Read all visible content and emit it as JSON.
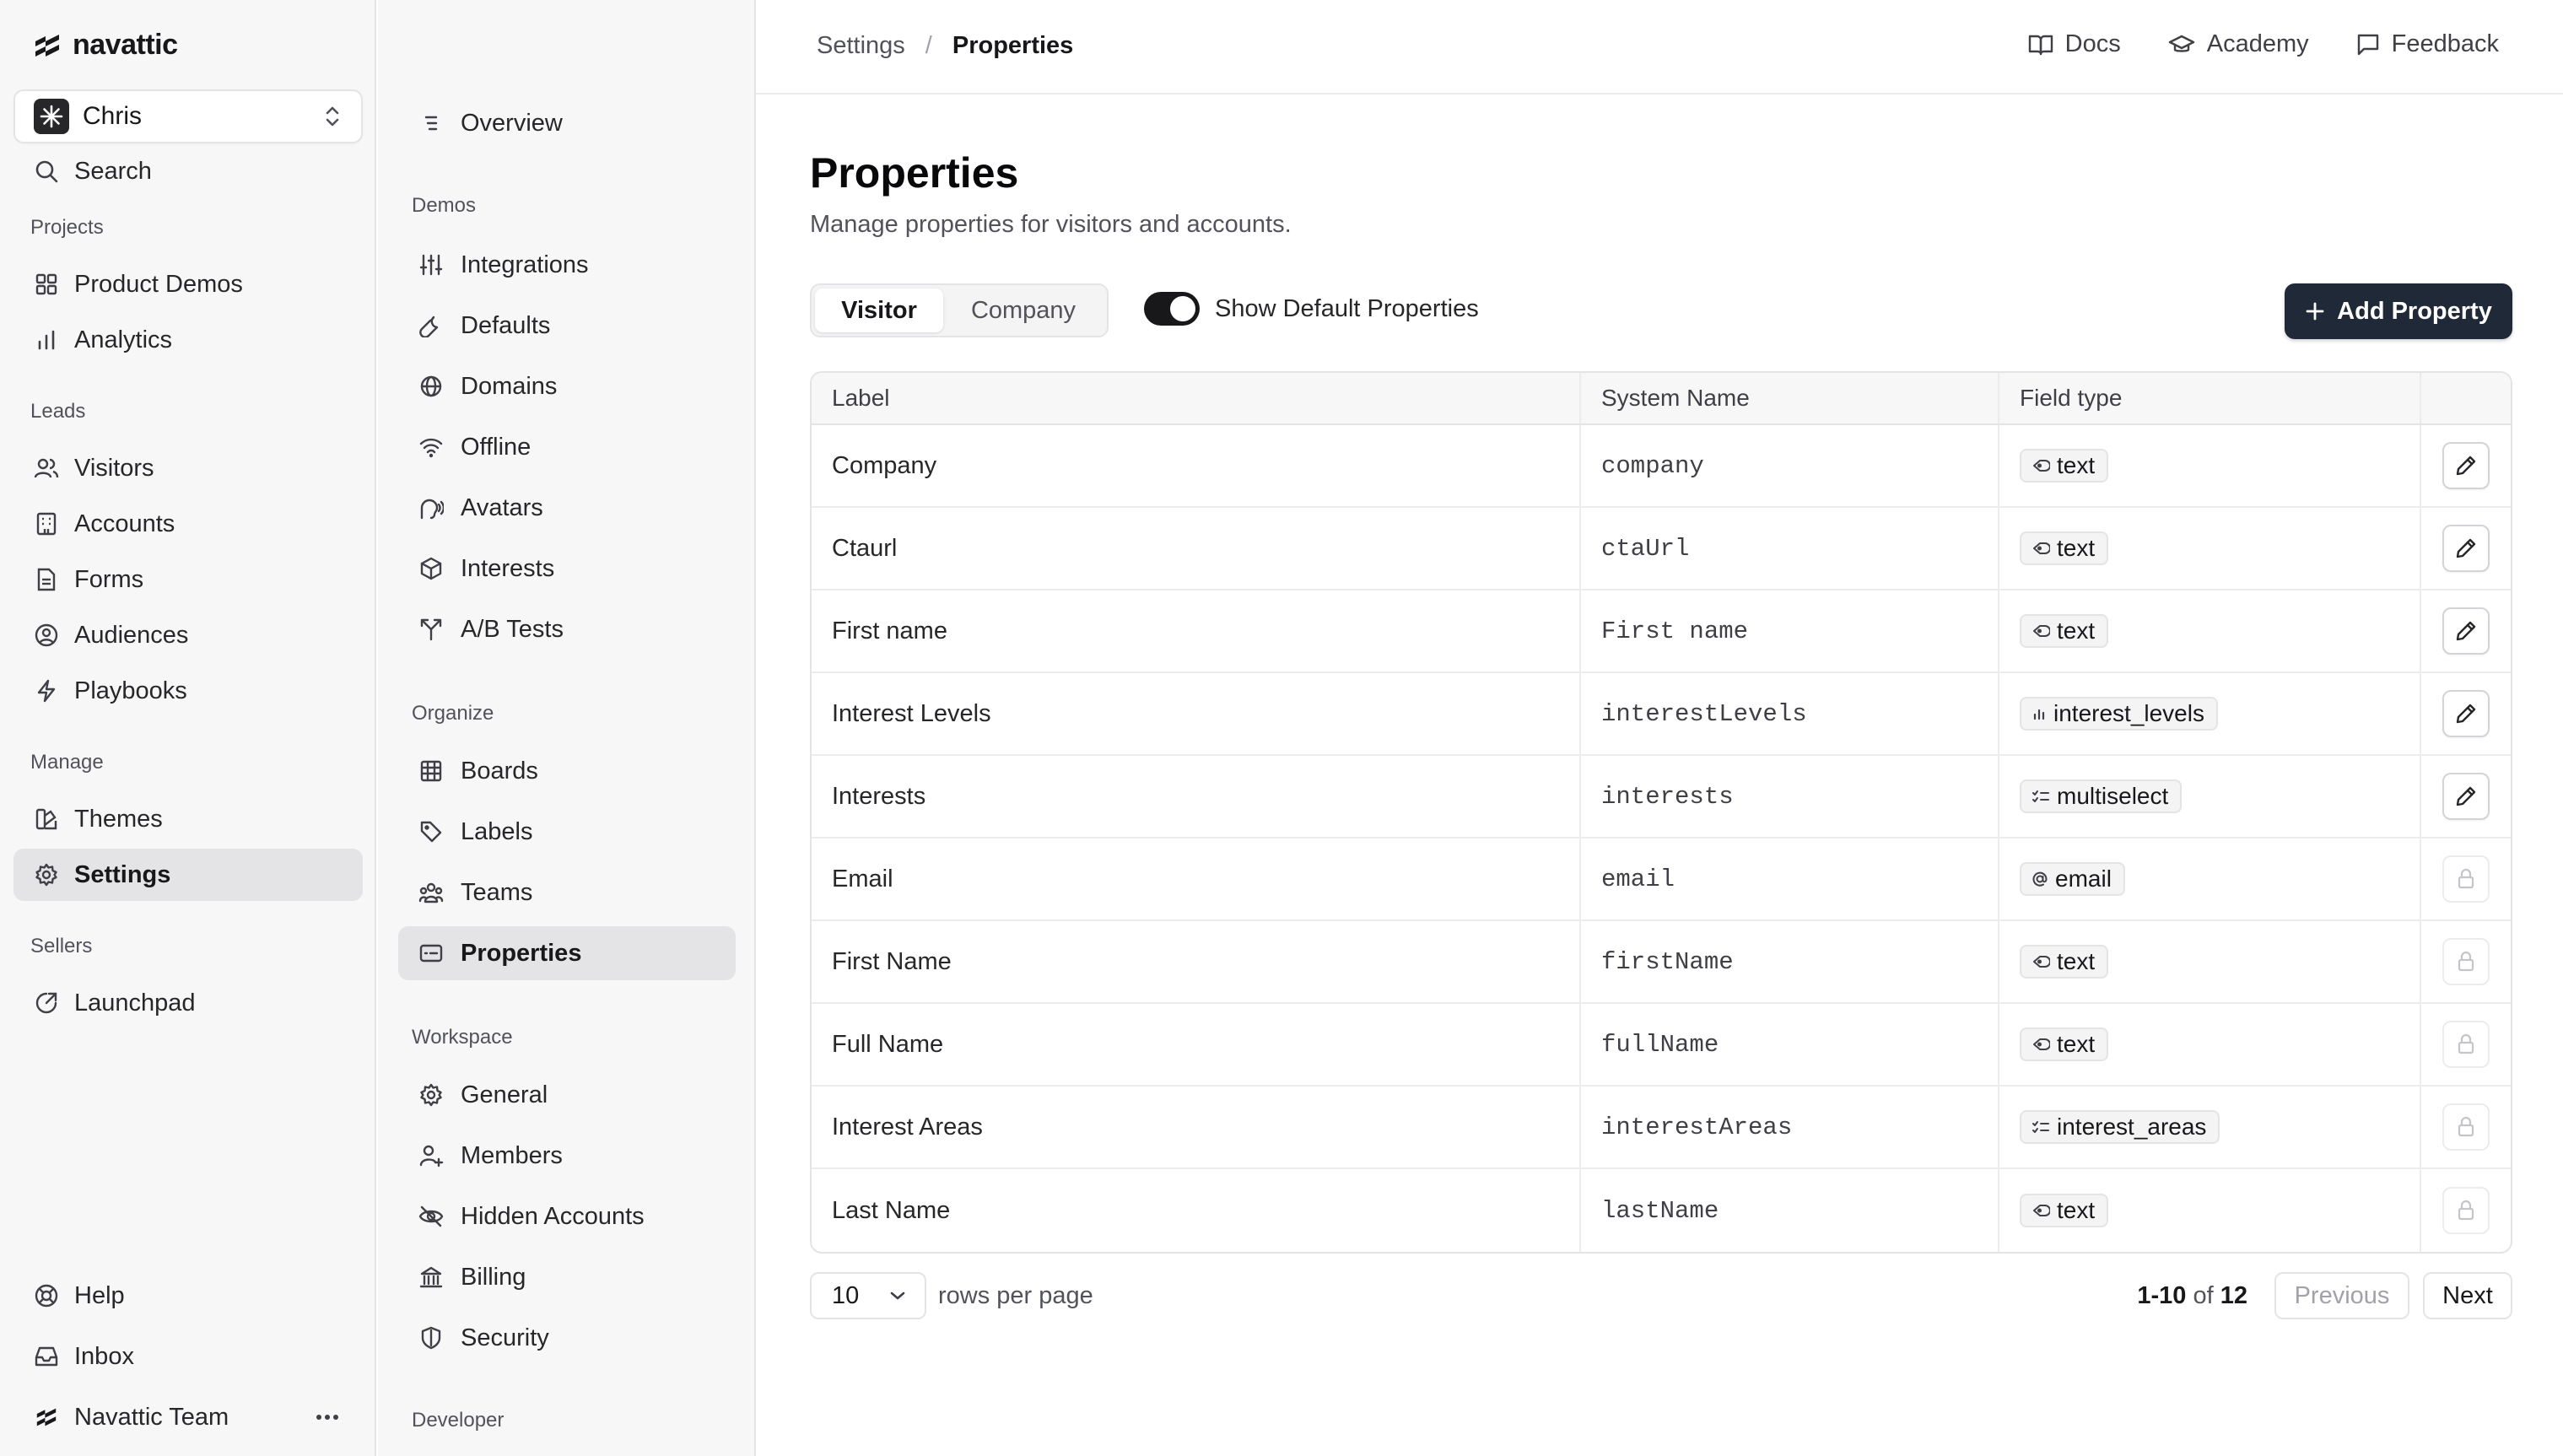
{
  "app": {
    "logo_text": "navattic"
  },
  "user": {
    "name": "Chris"
  },
  "sidebar": {
    "search_label": "Search",
    "sections": {
      "projects": "Projects",
      "leads": "Leads",
      "manage": "Manage",
      "sellers": "Sellers"
    },
    "items": {
      "product_demos": "Product Demos",
      "analytics": "Analytics",
      "visitors": "Visitors",
      "accounts": "Accounts",
      "forms": "Forms",
      "audiences": "Audiences",
      "playbooks": "Playbooks",
      "themes": "Themes",
      "settings": "Settings",
      "launchpad": "Launchpad"
    },
    "footer": {
      "help": "Help",
      "inbox": "Inbox",
      "team": "Navattic Team"
    }
  },
  "settings_nav": {
    "overview": "Overview",
    "sections": {
      "demos": "Demos",
      "organize": "Organize",
      "workspace": "Workspace",
      "developer": "Developer"
    },
    "demos": [
      "Integrations",
      "Defaults",
      "Domains",
      "Offline",
      "Avatars",
      "Interests",
      "A/B Tests"
    ],
    "organize": [
      "Boards",
      "Labels",
      "Teams",
      "Properties"
    ],
    "workspace": [
      "General",
      "Members",
      "Hidden Accounts",
      "Billing",
      "Security"
    ]
  },
  "topbar": {
    "breadcrumb_parent": "Settings",
    "breadcrumb_separator": "/",
    "breadcrumb_current": "Properties",
    "links": {
      "docs": "Docs",
      "academy": "Academy",
      "feedback": "Feedback"
    }
  },
  "page": {
    "title": "Properties",
    "subtitle": "Manage properties for visitors and accounts.",
    "tabs": {
      "visitor": "Visitor",
      "company": "Company"
    },
    "toggle_label": "Show Default Properties",
    "toggle_on": true,
    "add_button": "Add Property"
  },
  "table": {
    "headers": {
      "label": "Label",
      "system_name": "System Name",
      "field_type": "Field type"
    },
    "rows": [
      {
        "label": "Company",
        "system": "company",
        "type": "text",
        "icon": "tag-icon",
        "editable": true
      },
      {
        "label": "Ctaurl",
        "system": "ctaUrl",
        "type": "text",
        "icon": "tag-icon",
        "editable": true
      },
      {
        "label": "First name",
        "system": "First name",
        "type": "text",
        "icon": "tag-icon",
        "editable": true
      },
      {
        "label": "Interest Levels",
        "system": "interestLevels",
        "type": "interest_levels",
        "icon": "bars-icon",
        "editable": true
      },
      {
        "label": "Interests",
        "system": "interests",
        "type": "multiselect",
        "icon": "list-check-icon",
        "editable": true
      },
      {
        "label": "Email",
        "system": "email",
        "type": "email",
        "icon": "at-icon",
        "editable": false
      },
      {
        "label": "First Name",
        "system": "firstName",
        "type": "text",
        "icon": "tag-icon",
        "editable": false
      },
      {
        "label": "Full Name",
        "system": "fullName",
        "type": "text",
        "icon": "tag-icon",
        "editable": false
      },
      {
        "label": "Interest Areas",
        "system": "interestAreas",
        "type": "interest_areas",
        "icon": "list-check-icon",
        "editable": false
      },
      {
        "label": "Last Name",
        "system": "lastName",
        "type": "text",
        "icon": "tag-icon",
        "editable": false
      }
    ]
  },
  "pagination": {
    "rows_per_page_value": "10",
    "rows_per_page_label": "rows per page",
    "range": "1-10",
    "of": "of",
    "total": "12",
    "previous": "Previous",
    "next": "Next"
  }
}
